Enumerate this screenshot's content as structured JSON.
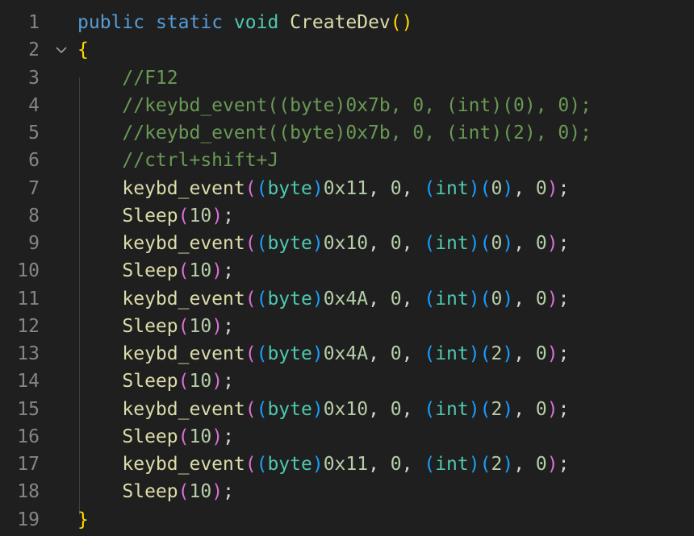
{
  "editor": {
    "lines": [
      {
        "n": "1",
        "tokens": [
          {
            "t": "public",
            "c": "#569cd6"
          },
          {
            "t": " ",
            "c": "#d4d4d4"
          },
          {
            "t": "static",
            "c": "#569cd6"
          },
          {
            "t": " ",
            "c": "#d4d4d4"
          },
          {
            "t": "void",
            "c": "#4ec9b0"
          },
          {
            "t": " ",
            "c": "#d4d4d4"
          },
          {
            "t": "CreateDev",
            "c": "#dcdcaa"
          },
          {
            "t": "()",
            "c": "#ffd700"
          }
        ]
      },
      {
        "n": "2",
        "fold": true,
        "tokens": [
          {
            "t": "{",
            "c": "#ffd700"
          }
        ]
      },
      {
        "n": "3",
        "tokens": [
          {
            "t": "    //F12",
            "c": "#6a9955"
          }
        ]
      },
      {
        "n": "4",
        "tokens": [
          {
            "t": "    //keybd_event((byte)0x7b, 0, (int)(0), 0);",
            "c": "#6a9955"
          }
        ]
      },
      {
        "n": "5",
        "tokens": [
          {
            "t": "    //keybd_event((byte)0x7b, 0, (int)(2), 0);",
            "c": "#6a9955"
          }
        ]
      },
      {
        "n": "6",
        "tokens": [
          {
            "t": "    //ctrl+shift+J",
            "c": "#6a9955"
          }
        ]
      },
      {
        "n": "7",
        "tokens": [
          {
            "t": "    ",
            "c": "#d4d4d4"
          },
          {
            "t": "keybd_event",
            "c": "#dcdcaa"
          },
          {
            "t": "(",
            "c": "#da70d6"
          },
          {
            "t": "(",
            "c": "#179fff"
          },
          {
            "t": "byte",
            "c": "#4ec9b0"
          },
          {
            "t": ")",
            "c": "#179fff"
          },
          {
            "t": "0x11",
            "c": "#b5cea8"
          },
          {
            "t": ", ",
            "c": "#d4d4d4"
          },
          {
            "t": "0",
            "c": "#b5cea8"
          },
          {
            "t": ", ",
            "c": "#d4d4d4"
          },
          {
            "t": "(",
            "c": "#179fff"
          },
          {
            "t": "int",
            "c": "#4ec9b0"
          },
          {
            "t": ")",
            "c": "#179fff"
          },
          {
            "t": "(",
            "c": "#179fff"
          },
          {
            "t": "0",
            "c": "#b5cea8"
          },
          {
            "t": ")",
            "c": "#179fff"
          },
          {
            "t": ", ",
            "c": "#d4d4d4"
          },
          {
            "t": "0",
            "c": "#b5cea8"
          },
          {
            "t": ")",
            "c": "#da70d6"
          },
          {
            "t": ";",
            "c": "#d4d4d4"
          }
        ]
      },
      {
        "n": "8",
        "tokens": [
          {
            "t": "    ",
            "c": "#d4d4d4"
          },
          {
            "t": "Sleep",
            "c": "#dcdcaa"
          },
          {
            "t": "(",
            "c": "#da70d6"
          },
          {
            "t": "10",
            "c": "#b5cea8"
          },
          {
            "t": ")",
            "c": "#da70d6"
          },
          {
            "t": ";",
            "c": "#d4d4d4"
          }
        ]
      },
      {
        "n": "9",
        "tokens": [
          {
            "t": "    ",
            "c": "#d4d4d4"
          },
          {
            "t": "keybd_event",
            "c": "#dcdcaa"
          },
          {
            "t": "(",
            "c": "#da70d6"
          },
          {
            "t": "(",
            "c": "#179fff"
          },
          {
            "t": "byte",
            "c": "#4ec9b0"
          },
          {
            "t": ")",
            "c": "#179fff"
          },
          {
            "t": "0x10",
            "c": "#b5cea8"
          },
          {
            "t": ", ",
            "c": "#d4d4d4"
          },
          {
            "t": "0",
            "c": "#b5cea8"
          },
          {
            "t": ", ",
            "c": "#d4d4d4"
          },
          {
            "t": "(",
            "c": "#179fff"
          },
          {
            "t": "int",
            "c": "#4ec9b0"
          },
          {
            "t": ")",
            "c": "#179fff"
          },
          {
            "t": "(",
            "c": "#179fff"
          },
          {
            "t": "0",
            "c": "#b5cea8"
          },
          {
            "t": ")",
            "c": "#179fff"
          },
          {
            "t": ", ",
            "c": "#d4d4d4"
          },
          {
            "t": "0",
            "c": "#b5cea8"
          },
          {
            "t": ")",
            "c": "#da70d6"
          },
          {
            "t": ";",
            "c": "#d4d4d4"
          }
        ]
      },
      {
        "n": "10",
        "tokens": [
          {
            "t": "    ",
            "c": "#d4d4d4"
          },
          {
            "t": "Sleep",
            "c": "#dcdcaa"
          },
          {
            "t": "(",
            "c": "#da70d6"
          },
          {
            "t": "10",
            "c": "#b5cea8"
          },
          {
            "t": ")",
            "c": "#da70d6"
          },
          {
            "t": ";",
            "c": "#d4d4d4"
          }
        ]
      },
      {
        "n": "11",
        "tokens": [
          {
            "t": "    ",
            "c": "#d4d4d4"
          },
          {
            "t": "keybd_event",
            "c": "#dcdcaa"
          },
          {
            "t": "(",
            "c": "#da70d6"
          },
          {
            "t": "(",
            "c": "#179fff"
          },
          {
            "t": "byte",
            "c": "#4ec9b0"
          },
          {
            "t": ")",
            "c": "#179fff"
          },
          {
            "t": "0x4A",
            "c": "#b5cea8"
          },
          {
            "t": ", ",
            "c": "#d4d4d4"
          },
          {
            "t": "0",
            "c": "#b5cea8"
          },
          {
            "t": ", ",
            "c": "#d4d4d4"
          },
          {
            "t": "(",
            "c": "#179fff"
          },
          {
            "t": "int",
            "c": "#4ec9b0"
          },
          {
            "t": ")",
            "c": "#179fff"
          },
          {
            "t": "(",
            "c": "#179fff"
          },
          {
            "t": "0",
            "c": "#b5cea8"
          },
          {
            "t": ")",
            "c": "#179fff"
          },
          {
            "t": ", ",
            "c": "#d4d4d4"
          },
          {
            "t": "0",
            "c": "#b5cea8"
          },
          {
            "t": ")",
            "c": "#da70d6"
          },
          {
            "t": ";",
            "c": "#d4d4d4"
          }
        ]
      },
      {
        "n": "12",
        "tokens": [
          {
            "t": "    ",
            "c": "#d4d4d4"
          },
          {
            "t": "Sleep",
            "c": "#dcdcaa"
          },
          {
            "t": "(",
            "c": "#da70d6"
          },
          {
            "t": "10",
            "c": "#b5cea8"
          },
          {
            "t": ")",
            "c": "#da70d6"
          },
          {
            "t": ";",
            "c": "#d4d4d4"
          }
        ]
      },
      {
        "n": "13",
        "tokens": [
          {
            "t": "    ",
            "c": "#d4d4d4"
          },
          {
            "t": "keybd_event",
            "c": "#dcdcaa"
          },
          {
            "t": "(",
            "c": "#da70d6"
          },
          {
            "t": "(",
            "c": "#179fff"
          },
          {
            "t": "byte",
            "c": "#4ec9b0"
          },
          {
            "t": ")",
            "c": "#179fff"
          },
          {
            "t": "0x4A",
            "c": "#b5cea8"
          },
          {
            "t": ", ",
            "c": "#d4d4d4"
          },
          {
            "t": "0",
            "c": "#b5cea8"
          },
          {
            "t": ", ",
            "c": "#d4d4d4"
          },
          {
            "t": "(",
            "c": "#179fff"
          },
          {
            "t": "int",
            "c": "#4ec9b0"
          },
          {
            "t": ")",
            "c": "#179fff"
          },
          {
            "t": "(",
            "c": "#179fff"
          },
          {
            "t": "2",
            "c": "#b5cea8"
          },
          {
            "t": ")",
            "c": "#179fff"
          },
          {
            "t": ", ",
            "c": "#d4d4d4"
          },
          {
            "t": "0",
            "c": "#b5cea8"
          },
          {
            "t": ")",
            "c": "#da70d6"
          },
          {
            "t": ";",
            "c": "#d4d4d4"
          }
        ]
      },
      {
        "n": "14",
        "tokens": [
          {
            "t": "    ",
            "c": "#d4d4d4"
          },
          {
            "t": "Sleep",
            "c": "#dcdcaa"
          },
          {
            "t": "(",
            "c": "#da70d6"
          },
          {
            "t": "10",
            "c": "#b5cea8"
          },
          {
            "t": ")",
            "c": "#da70d6"
          },
          {
            "t": ";",
            "c": "#d4d4d4"
          }
        ]
      },
      {
        "n": "15",
        "tokens": [
          {
            "t": "    ",
            "c": "#d4d4d4"
          },
          {
            "t": "keybd_event",
            "c": "#dcdcaa"
          },
          {
            "t": "(",
            "c": "#da70d6"
          },
          {
            "t": "(",
            "c": "#179fff"
          },
          {
            "t": "byte",
            "c": "#4ec9b0"
          },
          {
            "t": ")",
            "c": "#179fff"
          },
          {
            "t": "0x10",
            "c": "#b5cea8"
          },
          {
            "t": ", ",
            "c": "#d4d4d4"
          },
          {
            "t": "0",
            "c": "#b5cea8"
          },
          {
            "t": ", ",
            "c": "#d4d4d4"
          },
          {
            "t": "(",
            "c": "#179fff"
          },
          {
            "t": "int",
            "c": "#4ec9b0"
          },
          {
            "t": ")",
            "c": "#179fff"
          },
          {
            "t": "(",
            "c": "#179fff"
          },
          {
            "t": "2",
            "c": "#b5cea8"
          },
          {
            "t": ")",
            "c": "#179fff"
          },
          {
            "t": ", ",
            "c": "#d4d4d4"
          },
          {
            "t": "0",
            "c": "#b5cea8"
          },
          {
            "t": ")",
            "c": "#da70d6"
          },
          {
            "t": ";",
            "c": "#d4d4d4"
          }
        ]
      },
      {
        "n": "16",
        "tokens": [
          {
            "t": "    ",
            "c": "#d4d4d4"
          },
          {
            "t": "Sleep",
            "c": "#dcdcaa"
          },
          {
            "t": "(",
            "c": "#da70d6"
          },
          {
            "t": "10",
            "c": "#b5cea8"
          },
          {
            "t": ")",
            "c": "#da70d6"
          },
          {
            "t": ";",
            "c": "#d4d4d4"
          }
        ]
      },
      {
        "n": "17",
        "tokens": [
          {
            "t": "    ",
            "c": "#d4d4d4"
          },
          {
            "t": "keybd_event",
            "c": "#dcdcaa"
          },
          {
            "t": "(",
            "c": "#da70d6"
          },
          {
            "t": "(",
            "c": "#179fff"
          },
          {
            "t": "byte",
            "c": "#4ec9b0"
          },
          {
            "t": ")",
            "c": "#179fff"
          },
          {
            "t": "0x11",
            "c": "#b5cea8"
          },
          {
            "t": ", ",
            "c": "#d4d4d4"
          },
          {
            "t": "0",
            "c": "#b5cea8"
          },
          {
            "t": ", ",
            "c": "#d4d4d4"
          },
          {
            "t": "(",
            "c": "#179fff"
          },
          {
            "t": "int",
            "c": "#4ec9b0"
          },
          {
            "t": ")",
            "c": "#179fff"
          },
          {
            "t": "(",
            "c": "#179fff"
          },
          {
            "t": "2",
            "c": "#b5cea8"
          },
          {
            "t": ")",
            "c": "#179fff"
          },
          {
            "t": ", ",
            "c": "#d4d4d4"
          },
          {
            "t": "0",
            "c": "#b5cea8"
          },
          {
            "t": ")",
            "c": "#da70d6"
          },
          {
            "t": ";",
            "c": "#d4d4d4"
          }
        ]
      },
      {
        "n": "18",
        "tokens": [
          {
            "t": "    ",
            "c": "#d4d4d4"
          },
          {
            "t": "Sleep",
            "c": "#dcdcaa"
          },
          {
            "t": "(",
            "c": "#da70d6"
          },
          {
            "t": "10",
            "c": "#b5cea8"
          },
          {
            "t": ")",
            "c": "#da70d6"
          },
          {
            "t": ";",
            "c": "#d4d4d4"
          }
        ]
      },
      {
        "n": "19",
        "tokens": [
          {
            "t": "}",
            "c": "#ffd700"
          }
        ]
      }
    ],
    "fold_icon": "chevron-down-icon"
  },
  "colors": {
    "background": "#1f1f1f",
    "line_number": "#858585",
    "indent_guide": "#404040"
  }
}
